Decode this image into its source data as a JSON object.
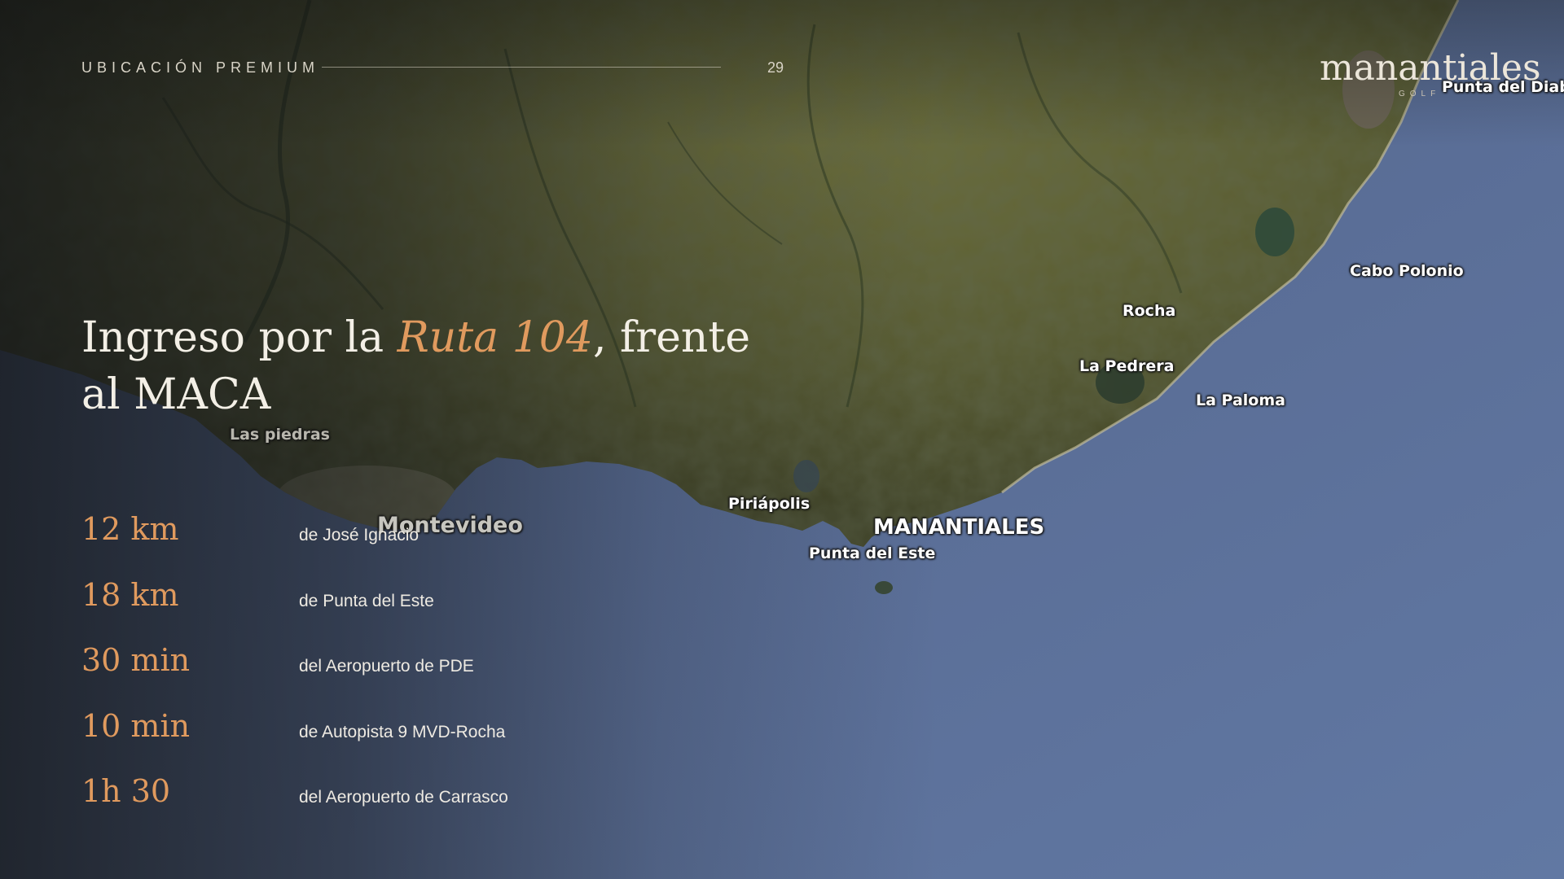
{
  "header": {
    "section_label": "UBICACIÓN PREMIUM",
    "page_number": "29"
  },
  "logo": {
    "wordmark": "manantiales",
    "subtitle": "GOLF"
  },
  "headline": {
    "part1": "Ingreso por la ",
    "accent": "Ruta 104",
    "part2": ", frente al MACA"
  },
  "stats": [
    {
      "value": "12 km",
      "description": "de José Ignacio"
    },
    {
      "value": "18 km",
      "description": "de Punta del Este"
    },
    {
      "value": "30 min",
      "description": "del Aeropuerto de PDE"
    },
    {
      "value": "10 min",
      "description": "de Autopista 9 MVD-Rocha"
    },
    {
      "value": "1h 30",
      "description": "del Aeropuerto de Carrasco"
    }
  ],
  "map": {
    "labels": {
      "punta_del_diablo": "Punta del Diablo",
      "cabo_polonio": "Cabo Polonio",
      "rocha": "Rocha",
      "la_pedrera": "La Pedrera",
      "la_paloma": "La Paloma",
      "las_piedras": "Las piedras",
      "montevideo": "Montevideo",
      "piriapolis": "Piriápolis",
      "manantiales": "MANANTIALES",
      "punta_del_este": "Punta del Este"
    }
  },
  "colors": {
    "accent": "#e09a5e",
    "text_light": "#f3efe6",
    "ocean": "#5a6e96",
    "land": "#5e6134"
  }
}
